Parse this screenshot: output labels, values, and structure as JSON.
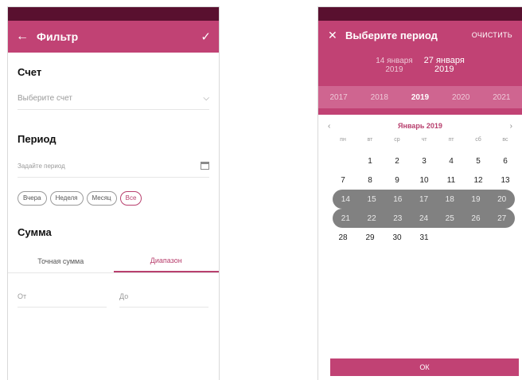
{
  "filter": {
    "title": "Фильтр",
    "account": {
      "label": "Счет",
      "placeholder": "Выберите счет"
    },
    "period": {
      "label": "Период",
      "placeholder": "Задайте период"
    },
    "quick_periods": [
      "Вчера",
      "Неделя",
      "Месяц",
      "Все"
    ],
    "active_quick_period": "Все",
    "amount": {
      "label": "Сумма",
      "tabs": [
        "Точная сумма",
        "Диапазон"
      ],
      "active_tab": "Диапазон",
      "from_placeholder": "От",
      "to_placeholder": "До"
    }
  },
  "picker": {
    "title": "Выберите период",
    "clear_label": "ОЧИСТИТЬ",
    "range_start": {
      "day_month": "14 января",
      "year": "2019"
    },
    "range_end": {
      "day_month": "27 января",
      "year": "2019"
    },
    "years": [
      "2017",
      "2018",
      "2019",
      "2020",
      "2021"
    ],
    "selected_year": "2019",
    "month_label": "Январь 2019",
    "weekdays": [
      "пн",
      "вт",
      "ср",
      "чт",
      "пт",
      "сб",
      "вс"
    ],
    "weeks": [
      [
        "",
        "1",
        "2",
        "3",
        "4",
        "5",
        "6"
      ],
      [
        "7",
        "8",
        "9",
        "10",
        "11",
        "12",
        "13"
      ],
      [
        "14",
        "15",
        "16",
        "17",
        "18",
        "19",
        "20"
      ],
      [
        "21",
        "22",
        "23",
        "24",
        "25",
        "26",
        "27"
      ],
      [
        "28",
        "29",
        "30",
        "31",
        "",
        "",
        ""
      ]
    ],
    "selected_weeks": [
      2,
      3
    ],
    "ok_label": "ОК"
  },
  "colors": {
    "accent": "#c14274",
    "status_bar": "#59102f",
    "selection": "#818181"
  }
}
